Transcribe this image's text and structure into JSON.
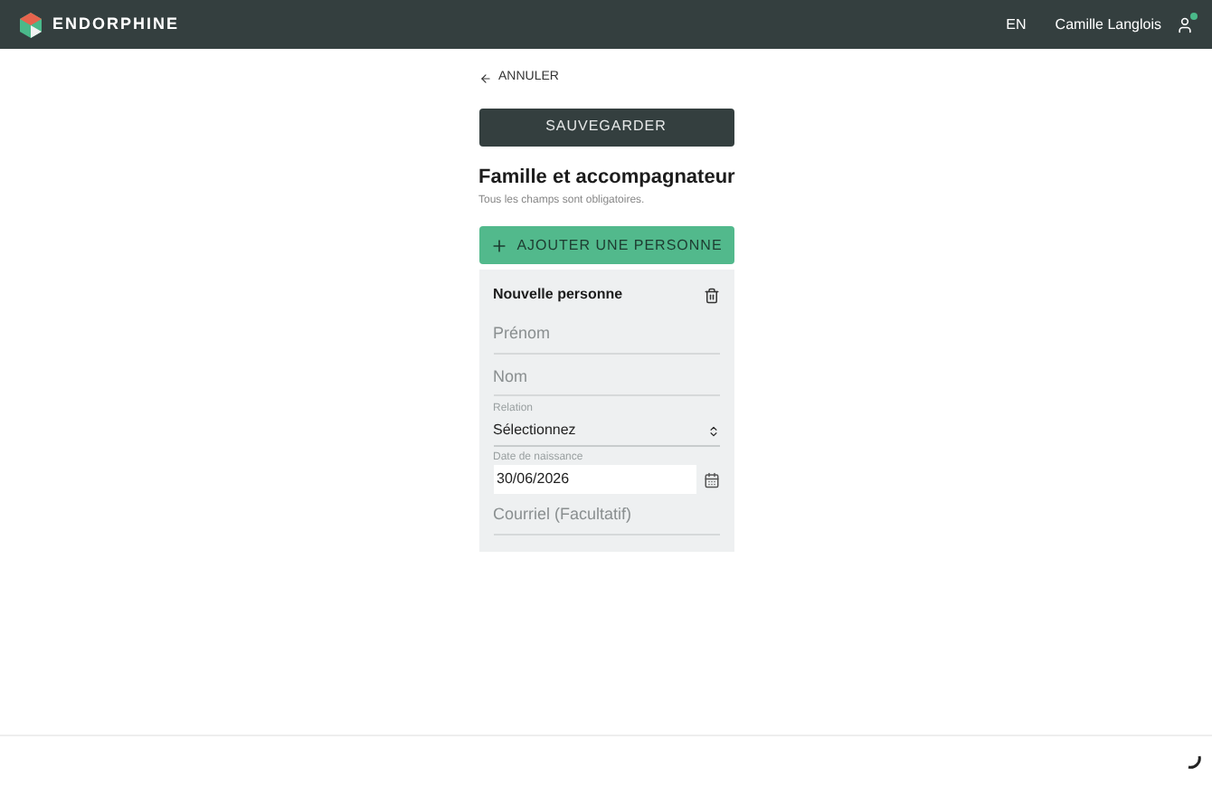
{
  "header": {
    "brand": "ENDORPHINE",
    "language": "EN",
    "user": "Camille Langlois",
    "notification": true
  },
  "back_link": "ANNULER",
  "save_button": "SAUVEGARDER",
  "section": {
    "title": "Famille et accompagnateur",
    "subtitle": "Tous les champs sont obligatoires."
  },
  "add_button": "AJOUTER UNE PERSONNE",
  "person_card": {
    "title": "Nouvelle personne",
    "fields": [
      {
        "kind": "text",
        "placeholder": "Prénom"
      },
      {
        "kind": "text",
        "placeholder": "Nom"
      },
      {
        "kind": "select",
        "label": "Relation",
        "value": "Sélectionnez"
      },
      {
        "kind": "date",
        "label": "Date de naissance",
        "value": "30/06/2026"
      },
      {
        "kind": "text",
        "placeholder": "Courriel (Facultatif)"
      }
    ]
  }
}
